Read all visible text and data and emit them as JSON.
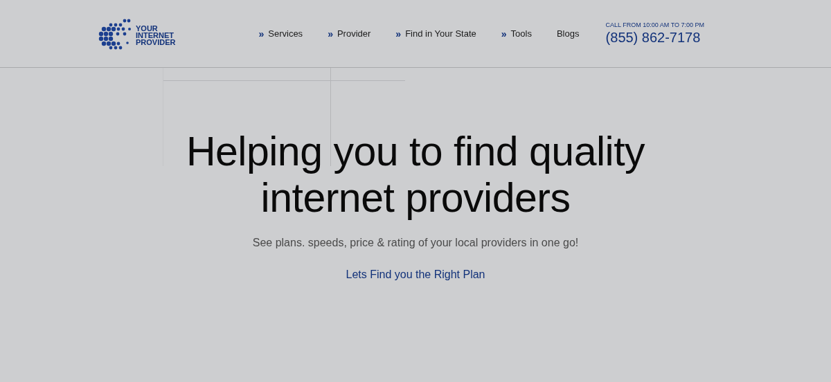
{
  "logo": {
    "text": [
      "YOUR",
      "INTERNET",
      "PROVIDER"
    ]
  },
  "nav": [
    {
      "label": "Services",
      "marker": "»"
    },
    {
      "label": "Provider",
      "marker": "»"
    },
    {
      "label": "Find in Your State",
      "marker": "»"
    },
    {
      "label": "Tools",
      "marker": "»"
    },
    {
      "label": "Blogs"
    }
  ],
  "contact": {
    "hours": "CALL FROM 10:00 AM TO 7:00 PM",
    "phone": "(855) 862-7178"
  },
  "hero": {
    "heading": [
      "Helping you to find quality",
      "internet providers"
    ],
    "subtitle": "See plans. speeds, price & rating of your local providers in one go!",
    "link": "Lets Find you the Right Plan"
  }
}
